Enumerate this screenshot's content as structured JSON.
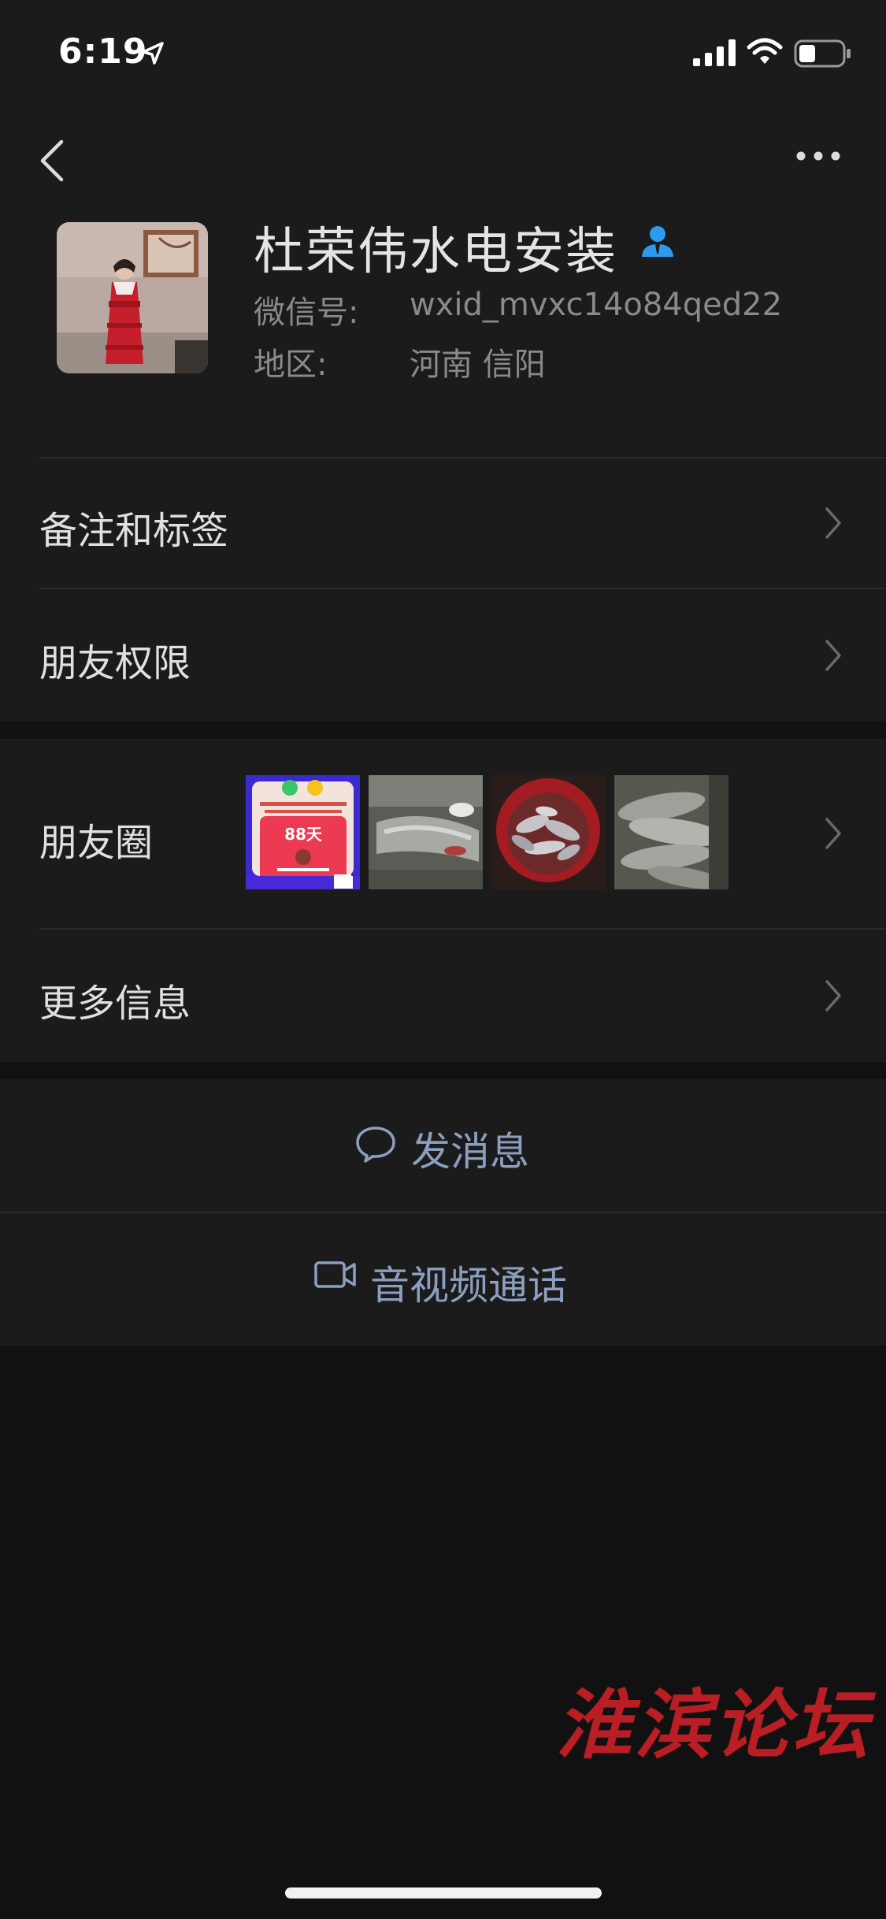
{
  "status": {
    "time": "6:19"
  },
  "profile": {
    "name": "杜荣伟水电安装",
    "wechat_id_label": "微信号:",
    "wechat_id": "wxid_mvxc14o84qed22",
    "region_label": "地区:",
    "region": "河南 信阳"
  },
  "menu": {
    "remarks": "备注和标签",
    "permissions": "朋友权限",
    "moments": "朋友圈",
    "more_info": "更多信息"
  },
  "moments_thumb1": {
    "price_text": "88天"
  },
  "actions": {
    "message": "发消息",
    "call": "音视频通话"
  },
  "watermark": "淮滨论坛",
  "colors": {
    "accent": "#8d9fc0",
    "badge": "#2b9bf0",
    "background": "#111111",
    "panel": "#1b1b1b"
  }
}
